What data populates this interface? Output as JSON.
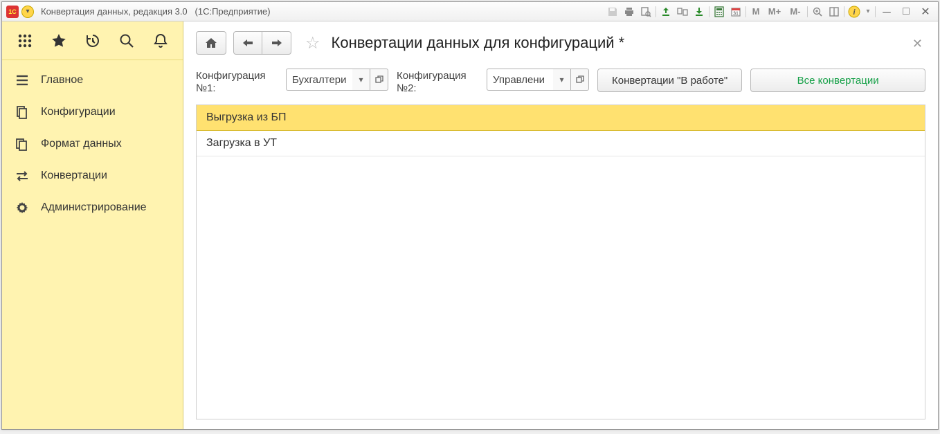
{
  "window": {
    "app_title": "Конвертация данных, редакция 3.0",
    "platform_suffix": "(1С:Предприятие)"
  },
  "sidebar": {
    "items": [
      {
        "icon": "menu-icon",
        "label": "Главное"
      },
      {
        "icon": "configs-icon",
        "label": "Конфигурации"
      },
      {
        "icon": "dataformat-icon",
        "label": "Формат данных"
      },
      {
        "icon": "conversions-icon",
        "label": "Конвертации"
      },
      {
        "icon": "admin-icon",
        "label": "Администрирование"
      }
    ]
  },
  "page": {
    "title": "Конвертации данных для конфигураций *"
  },
  "filters": {
    "config1_label": "Конфигурация №1:",
    "config1_value": "Бухгалтери",
    "config2_label": "Конфигурация №2:",
    "config2_value": "Управлени",
    "in_work_button": "Конвертации \"В работе\"",
    "all_button": "Все конвертации"
  },
  "list": {
    "rows": [
      {
        "label": "Выгрузка из БП",
        "selected": true
      },
      {
        "label": "Загрузка в УТ",
        "selected": false
      }
    ]
  },
  "toolbar_letters": {
    "m": "М",
    "mplus": "М+",
    "mminus": "М-"
  }
}
